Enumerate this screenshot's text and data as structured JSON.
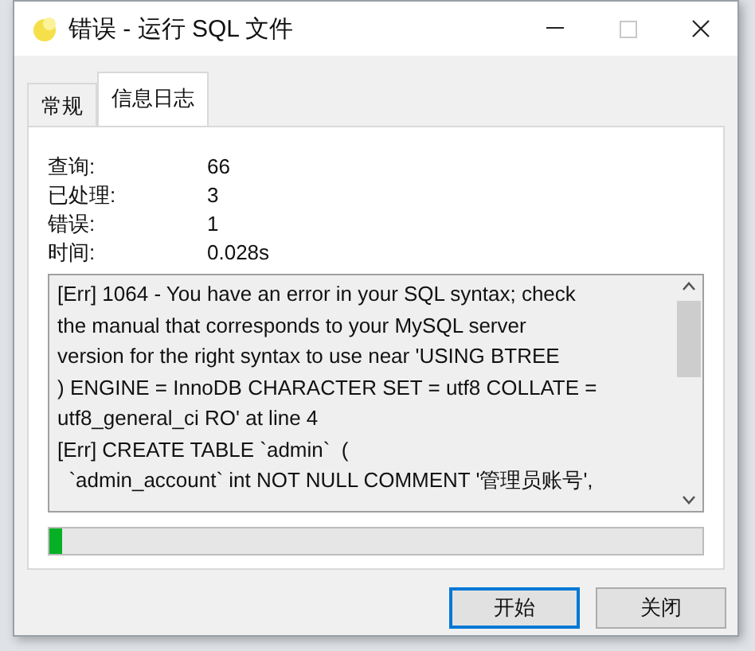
{
  "window": {
    "title": "错误 - 运行 SQL 文件"
  },
  "tabs": [
    {
      "label": "常规",
      "selected": false
    },
    {
      "label": "信息日志",
      "selected": true
    }
  ],
  "stats": [
    {
      "label": "查询:",
      "value": "66"
    },
    {
      "label": "已处理:",
      "value": "3"
    },
    {
      "label": "错误:",
      "value": "1"
    },
    {
      "label": "时间:",
      "value": "0.028s"
    }
  ],
  "log": {
    "lines": [
      "[Err] 1064 - You have an error in your SQL syntax; check",
      "the manual that corresponds to your MySQL server",
      "version for the right syntax to use near 'USING BTREE",
      ") ENGINE = InnoDB CHARACTER SET = utf8 COLLATE =",
      "utf8_general_ci RO' at line 4",
      "[Err] CREATE TABLE `admin`  (",
      "  `admin_account` int NOT NULL COMMENT '管理员账号',"
    ]
  },
  "progress": {
    "level": 0.02
  },
  "buttons": [
    {
      "label": "开始",
      "selected": true
    },
    {
      "label": "关闭",
      "selected": false
    }
  ]
}
